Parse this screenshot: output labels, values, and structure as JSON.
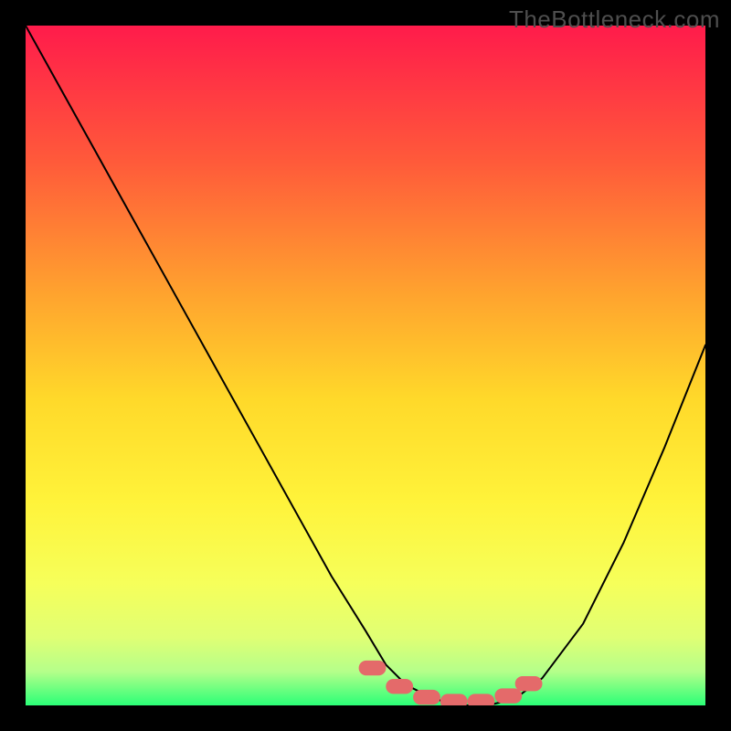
{
  "watermark": "TheBottleneck.com",
  "chart_data": {
    "type": "line",
    "title": "",
    "xlabel": "",
    "ylabel": "",
    "xlim": [
      0,
      100
    ],
    "ylim": [
      0,
      100
    ],
    "grid": false,
    "legend": false,
    "background_gradient": {
      "stops": [
        {
          "offset": 0.0,
          "color": "#ff1b4b"
        },
        {
          "offset": 0.2,
          "color": "#ff5a3a"
        },
        {
          "offset": 0.4,
          "color": "#ffa52e"
        },
        {
          "offset": 0.55,
          "color": "#ffd92a"
        },
        {
          "offset": 0.7,
          "color": "#fff33a"
        },
        {
          "offset": 0.82,
          "color": "#f6ff5a"
        },
        {
          "offset": 0.9,
          "color": "#e0ff74"
        },
        {
          "offset": 0.95,
          "color": "#b5ff8a"
        },
        {
          "offset": 1.0,
          "color": "#2bff77"
        }
      ]
    },
    "series": [
      {
        "name": "bottleneck-curve",
        "stroke": "#000000",
        "stroke_width": 2,
        "x": [
          0,
          5,
          10,
          15,
          20,
          25,
          30,
          35,
          40,
          45,
          50,
          53,
          56,
          60,
          64,
          68,
          72,
          76,
          82,
          88,
          94,
          100
        ],
        "values": [
          100,
          91,
          82,
          73,
          64,
          55,
          46,
          37,
          28,
          19,
          11,
          6,
          3,
          1,
          0,
          0,
          1,
          4,
          12,
          24,
          38,
          53
        ]
      }
    ],
    "markers": {
      "name": "optimal-range",
      "color": "#e46a6a",
      "shape": "rounded-rect",
      "approx_width": 4,
      "approx_height": 2.2,
      "points": [
        {
          "x": 51,
          "y": 5.5
        },
        {
          "x": 55,
          "y": 2.8
        },
        {
          "x": 59,
          "y": 1.2
        },
        {
          "x": 63,
          "y": 0.6
        },
        {
          "x": 67,
          "y": 0.6
        },
        {
          "x": 71,
          "y": 1.4
        },
        {
          "x": 74,
          "y": 3.2
        }
      ]
    }
  }
}
